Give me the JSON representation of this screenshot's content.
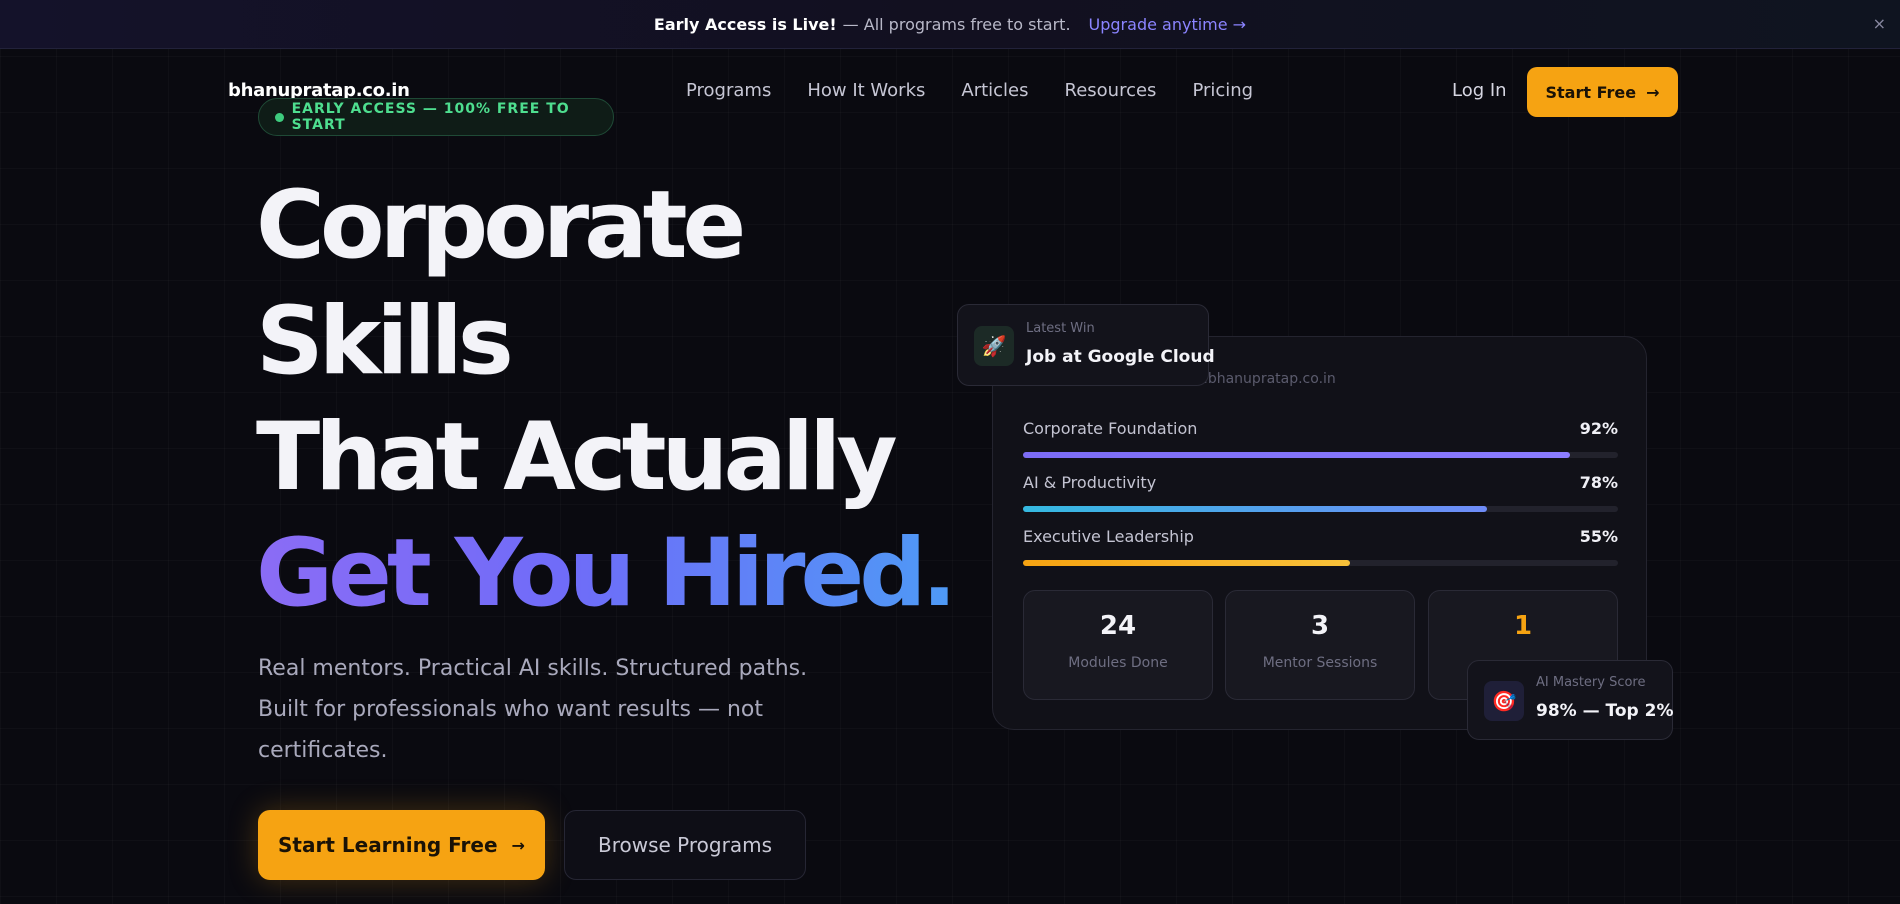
{
  "announcement": {
    "bold": "Early Access is Live!",
    "text": "— All programs free to start.",
    "link": "Upgrade anytime →",
    "close": "×"
  },
  "nav": {
    "logo": "bhanupratap.co.in",
    "items": [
      "Programs",
      "How It Works",
      "Articles",
      "Resources",
      "Pricing"
    ],
    "login": "Log In",
    "cta": "Start Free",
    "cta_arrow": "→"
  },
  "hero": {
    "pill": "EARLY ACCESS — 100% FREE TO START",
    "title_lines": [
      "Corporate",
      "Skills",
      "That Actually"
    ],
    "title_gradient": "Get You Hired.",
    "subtitle": "Real mentors. Practical AI skills. Structured paths. Built for professionals who want results — not certificates.",
    "primary_button": "Start Learning Free",
    "primary_arrow": "→",
    "secondary_button": "Browse Programs"
  },
  "dashboard": {
    "url": "rd.bhanupratap.co.in",
    "metrics": [
      {
        "label": "Corporate Foundation",
        "pct": "92%",
        "value": 92
      },
      {
        "label": "AI & Productivity",
        "pct": "78%",
        "value": 78
      },
      {
        "label": "Executive Leadership",
        "pct": "55%",
        "value": 55
      }
    ],
    "stats": [
      {
        "num": "24",
        "label": "Modules Done"
      },
      {
        "num": "3",
        "label": "Mentor Sessions"
      },
      {
        "num": "1",
        "label": ""
      }
    ]
  },
  "floating_win": {
    "small": "Latest Win",
    "big": "Job at Google Cloud",
    "icon": "rocket-icon"
  },
  "floating_score": {
    "small": "AI Mastery Score",
    "big": "98% — Top 2%",
    "icon": "target-icon"
  },
  "colors": {
    "accent": "#f6a312",
    "green": "#3ecb7e",
    "purple": "#7c6cf5",
    "blue": "#4e9af6"
  }
}
